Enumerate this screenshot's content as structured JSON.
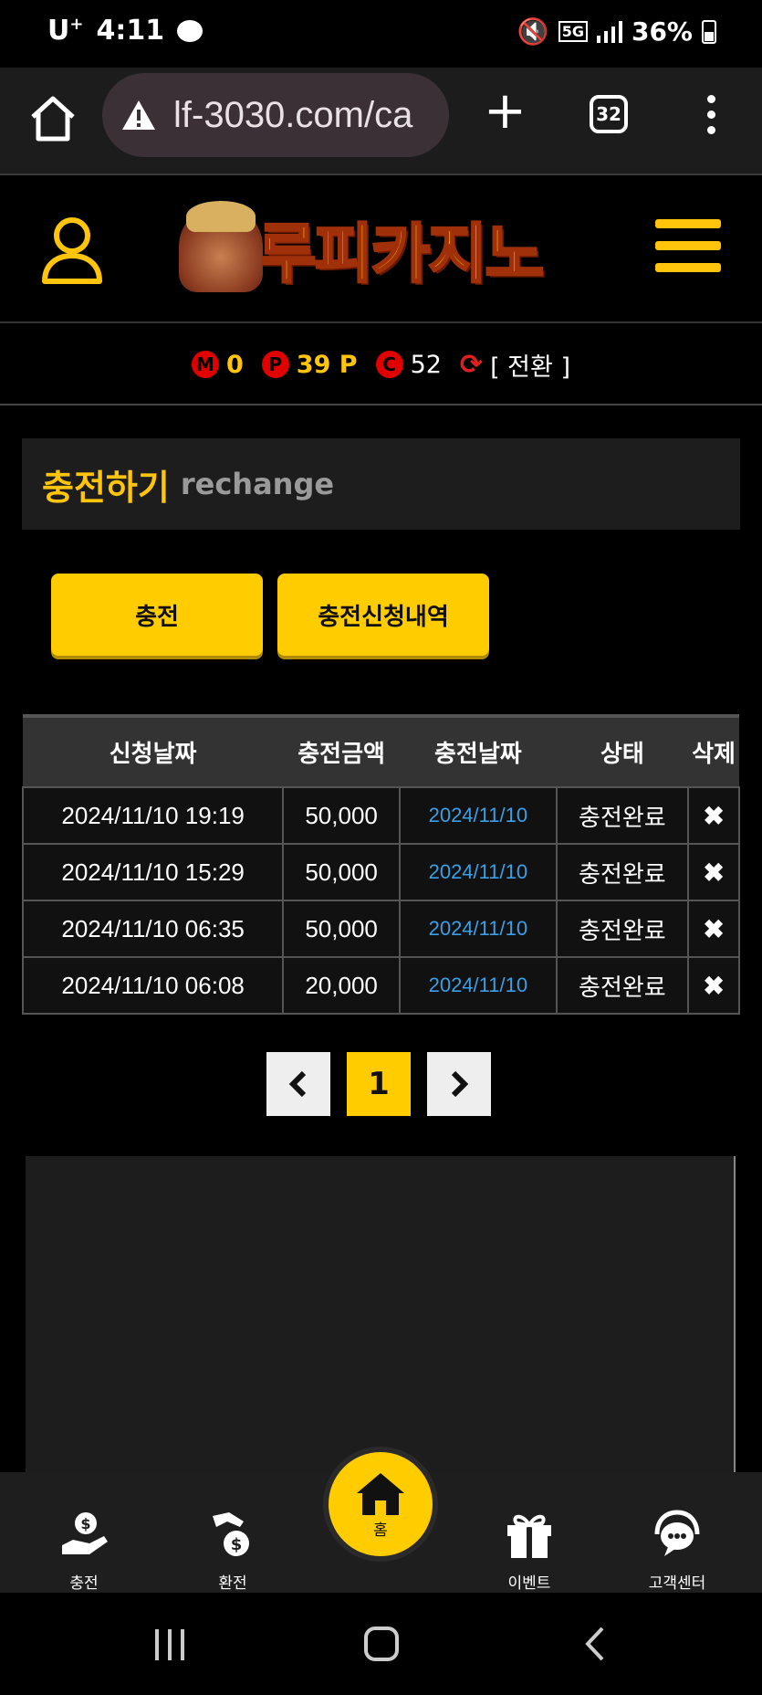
{
  "statusbar": {
    "carrier": "U",
    "time": "4:11",
    "network": "5G",
    "battery": "36%"
  },
  "browser": {
    "url": "lf-3030.com/ca",
    "tab_count": "32"
  },
  "header": {
    "logo_text": "루피카지노"
  },
  "points": {
    "m_label": "M",
    "m_value": "0",
    "p_label": "P",
    "p_value": "39 P",
    "c_label": "C",
    "c_value": "52",
    "convert_label": "[ 전환 ]"
  },
  "page_title": {
    "korean": "충전하기",
    "english": "rechange"
  },
  "buttons": {
    "charge": "충전",
    "history": "충전신청내역"
  },
  "table": {
    "headers": [
      "신청날짜",
      "충전금액",
      "충전날짜",
      "상태",
      "삭제"
    ],
    "rows": [
      {
        "request_date": "2024/11/10 19:19",
        "amount": "50,000",
        "charge_date": "2024/11/10",
        "status": "충전완료",
        "delete": "✖"
      },
      {
        "request_date": "2024/11/10 15:29",
        "amount": "50,000",
        "charge_date": "2024/11/10",
        "status": "충전완료",
        "delete": "✖"
      },
      {
        "request_date": "2024/11/10 06:35",
        "amount": "50,000",
        "charge_date": "2024/11/10",
        "status": "충전완료",
        "delete": "✖"
      },
      {
        "request_date": "2024/11/10 06:08",
        "amount": "20,000",
        "charge_date": "2024/11/10",
        "status": "충전완료",
        "delete": "✖"
      }
    ]
  },
  "pagination": {
    "current": "1"
  },
  "bottomnav": {
    "charge": "충전",
    "exchange": "환전",
    "home": "홈",
    "event": "이벤트",
    "support": "고객센터"
  },
  "colors": {
    "accent": "#ffcc00",
    "link_date": "#39a0e8",
    "coin_red": "#e00000"
  }
}
